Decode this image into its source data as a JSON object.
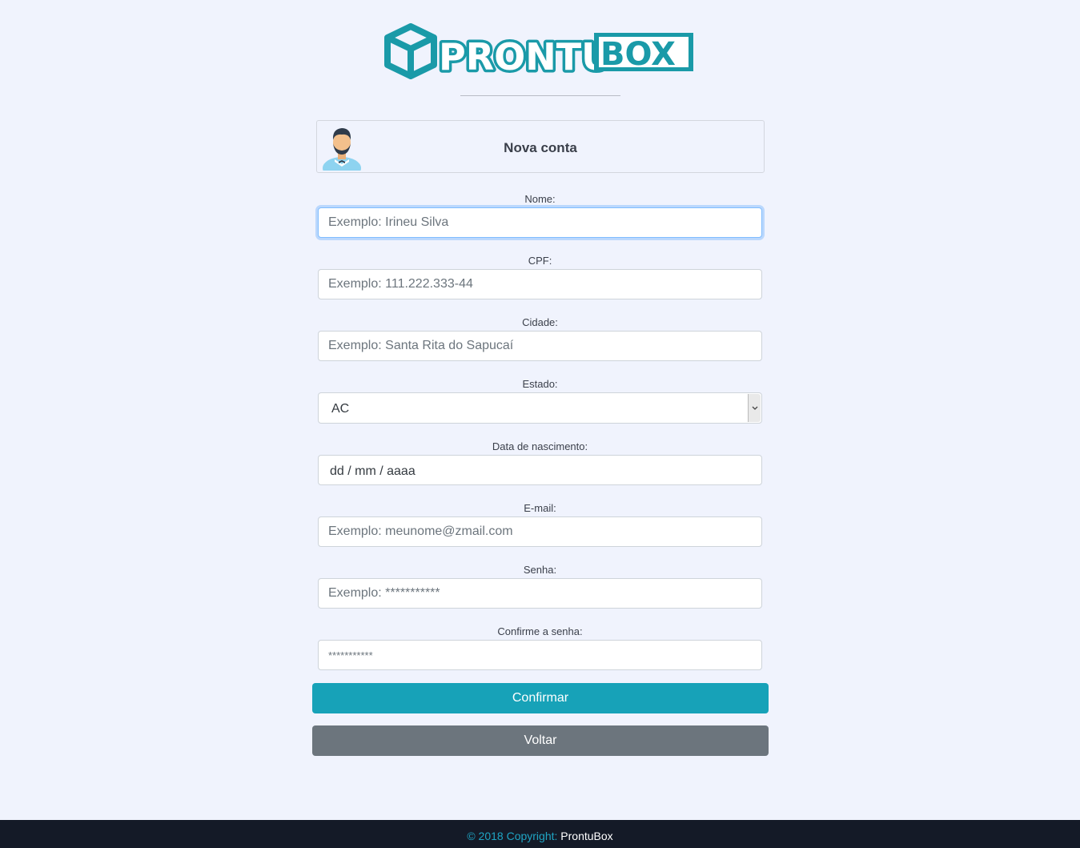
{
  "brand": {
    "logo_text": "PRONTUBOX",
    "logo_color": "#1a9aa8"
  },
  "header": {
    "title": "Nova conta",
    "avatar_icon": "user-avatar-icon"
  },
  "form": {
    "nome": {
      "label": "Nome:",
      "placeholder": "Exemplo: Irineu Silva",
      "value": ""
    },
    "cpf": {
      "label": "CPF:",
      "placeholder": "Exemplo: 111.222.333-44",
      "value": ""
    },
    "cidade": {
      "label": "Cidade:",
      "placeholder": "Exemplo: Santa Rita do Sapucaí",
      "value": ""
    },
    "estado": {
      "label": "Estado:",
      "selected": "AC"
    },
    "nascimento": {
      "label": "Data de nascimento:",
      "placeholder": "dd / mm / aaaa"
    },
    "email": {
      "label": "E-mail:",
      "placeholder": "Exemplo: meunome@zmail.com",
      "value": ""
    },
    "senha": {
      "label": "Senha:",
      "placeholder": "Exemplo: ***********",
      "value": ""
    },
    "confirmar_senha": {
      "label": "Confirme a senha:",
      "placeholder": "***********",
      "value": ""
    }
  },
  "buttons": {
    "confirm_label": "Confirmar",
    "back_label": "Voltar"
  },
  "footer": {
    "copyright": "© 2018 Copyright:",
    "brand": "ProntuBox"
  },
  "colors": {
    "accent": "#17a2b8",
    "secondary": "#6c757d",
    "background": "#f0f3fd",
    "footer": "#141a27"
  }
}
